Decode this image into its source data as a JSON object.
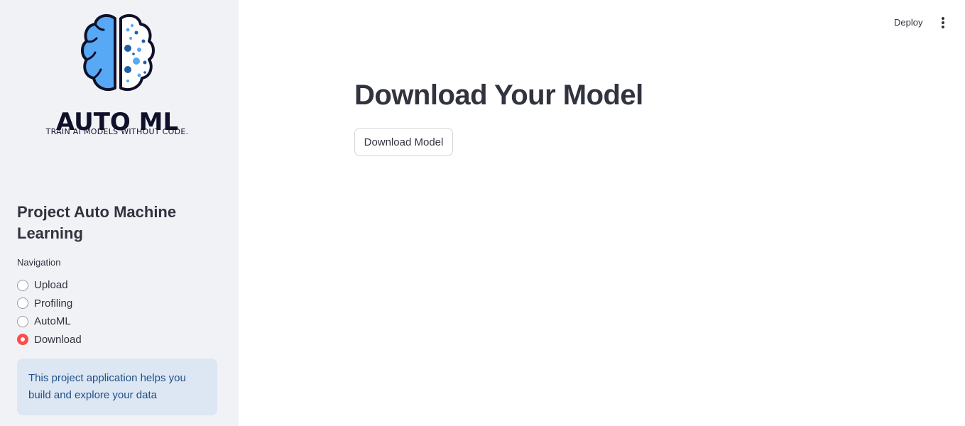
{
  "sidebar": {
    "logo": {
      "title": "AUTO ML",
      "tagline": "TRAIN AI MODELS WITHOUT CODE.",
      "icon": "brain-icon",
      "colors": {
        "left_lobe": "#57a8f5",
        "dots": "#1e5fa8",
        "outline": "#10102a"
      }
    },
    "project_title": "Project Auto Machine Learning",
    "navigation": {
      "label": "Navigation",
      "options": [
        {
          "label": "Upload",
          "selected": false
        },
        {
          "label": "Profiling",
          "selected": false
        },
        {
          "label": "AutoML",
          "selected": false
        },
        {
          "label": "Download",
          "selected": true
        }
      ]
    },
    "info_text": "This project application helps you build and explore your data"
  },
  "toolbar": {
    "deploy_label": "Deploy",
    "menu_icon": "more-vertical-icon"
  },
  "main": {
    "title": "Download Your Model",
    "download_button_label": "Download Model"
  },
  "colors": {
    "accent": "#ff4b4b",
    "sidebar_bg": "#f0f2f6",
    "info_bg": "#dde6f3",
    "info_text": "#1f4f86"
  }
}
